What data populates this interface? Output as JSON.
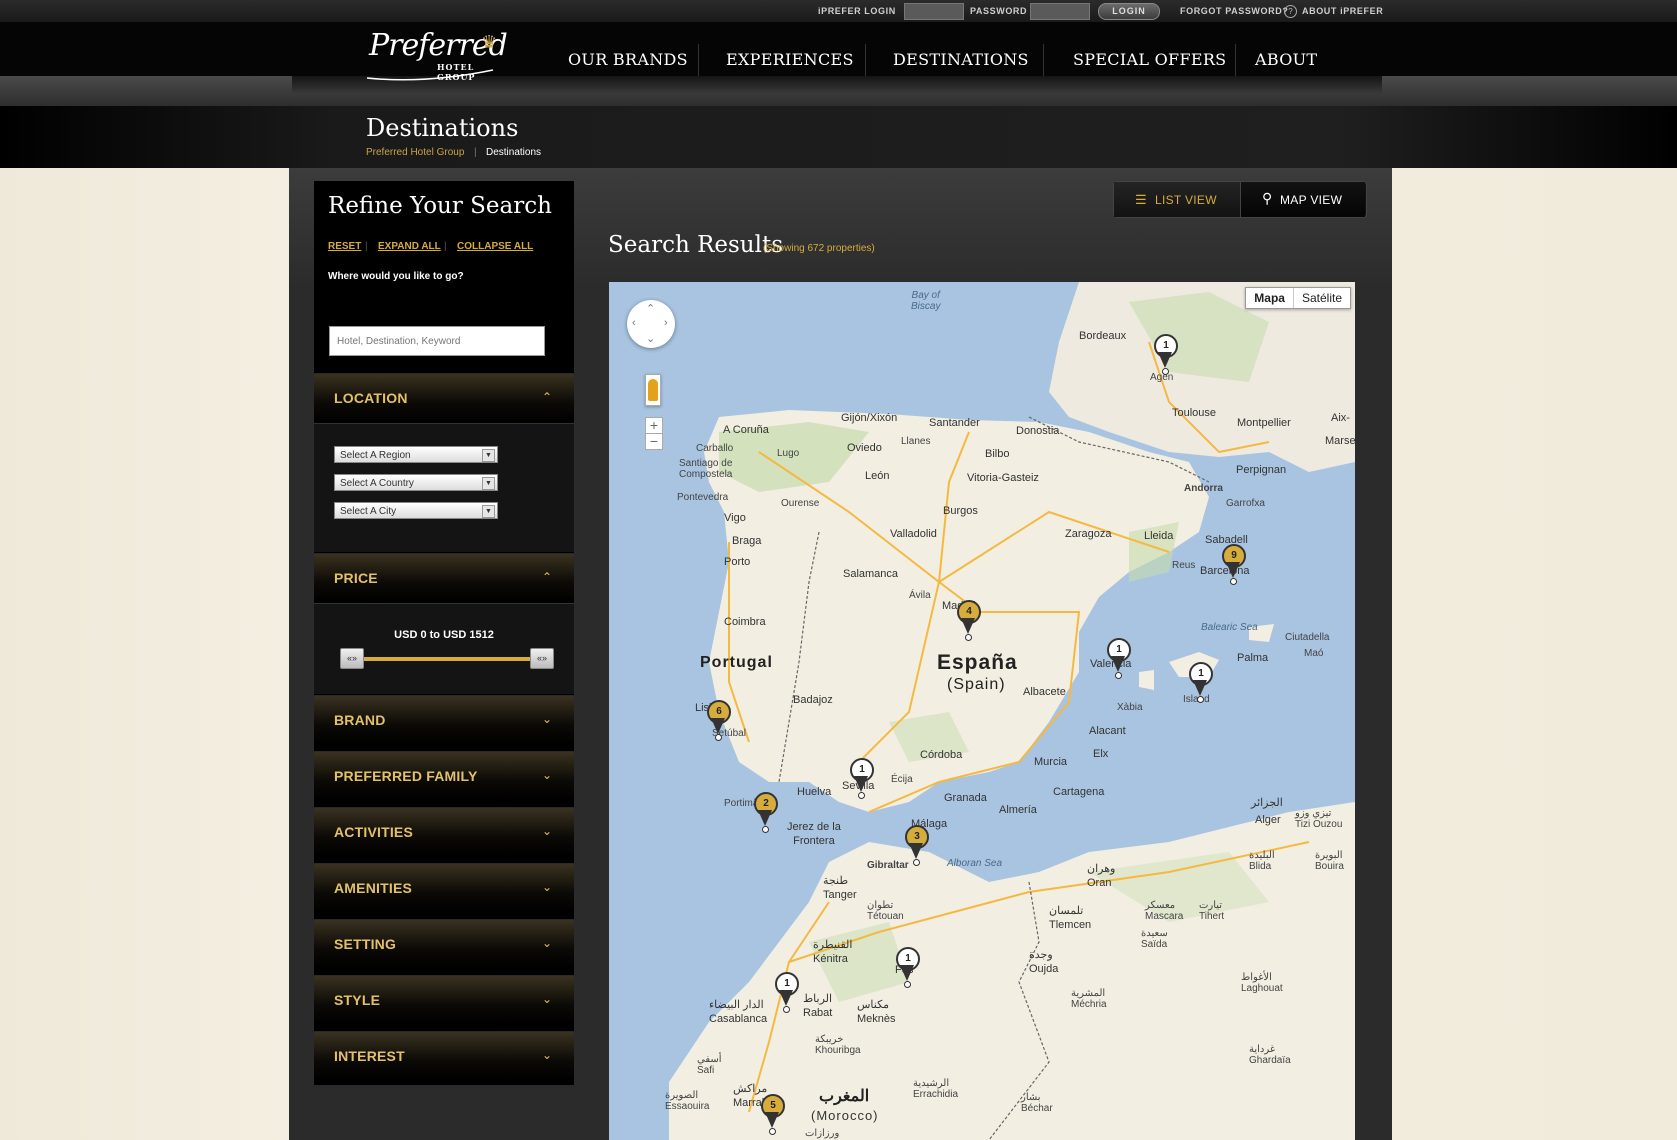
{
  "utility_bar": {
    "iprefer_login": "iPREFER LOGIN",
    "password": "PASSWORD",
    "login_button": "LOGIN",
    "forgot_password": "FORGOT PASSWORD?",
    "about_iprefer": "ABOUT iPREFER"
  },
  "logo": {
    "script": "Preferred",
    "sub": "HOTEL GROUP"
  },
  "nav": {
    "items": [
      "OUR BRANDS",
      "EXPERIENCES",
      "DESTINATIONS",
      "SPECIAL OFFERS",
      "ABOUT"
    ]
  },
  "page": {
    "title": "Destinations",
    "breadcrumb": [
      "Preferred Hotel Group",
      "Destinations"
    ],
    "breadcrumb_sep": "|"
  },
  "sidebar": {
    "title": "Refine Your Search",
    "links": [
      "RESET",
      "EXPAND ALL",
      "COLLAPSE ALL"
    ],
    "link_sep": "|",
    "where_label": "Where would you like to go?",
    "search_placeholder": "Hotel, Destination, Keyword",
    "sections": {
      "location": "LOCATION",
      "price": "PRICE",
      "brand": "BRAND",
      "preferred_family": "PREFERRED FAMILY",
      "activities": "ACTIVITIES",
      "amenities": "AMENITIES",
      "setting": "SETTING",
      "style": "STYLE",
      "interest": "INTEREST"
    },
    "selects": [
      "Select A Region",
      "Select A Country",
      "Select A City"
    ],
    "price_label": "USD 0 to USD 1512",
    "price_min": 0,
    "price_max": 1512,
    "handle_glyph": "«»"
  },
  "results": {
    "list_view": "LIST VIEW",
    "map_view": "MAP VIEW",
    "title": "Search Results",
    "count_text": "(Showing 672 properties)"
  },
  "map": {
    "type_map": "Mapa",
    "type_satellite": "Satélite",
    "labels": {
      "bay_of_biscay": "Bay of\nBiscay",
      "bordeaux": "Bordeaux",
      "agen": "Agen",
      "toulouse": "Toulouse",
      "montpellier": "Montpellier",
      "aix": "Aix-",
      "marse": "Marse",
      "perpignan": "Perpignan",
      "andorra": "Andorra",
      "figueres": "Garrofxa",
      "gijon": "Gijón/Xixón",
      "santander": "Santander",
      "donostia": "Donostia",
      "a_coruna": "A Coruña",
      "oviedo": "Oviedo",
      "llanes": "Llanes",
      "bilbo": "Bilbo",
      "carballo": "Carballo",
      "lugo": "Lugo",
      "vitoria": "Vitoria-Gasteiz",
      "santiago": "Santiago de\nCompostela",
      "leon": "León",
      "pontevedra": "Pontevedra",
      "ourense": "Ourense",
      "burgos": "Burgos",
      "vigo": "Vigo",
      "valladolid": "Valladolid",
      "zaragoza": "Zaragoza",
      "lleida": "Lleida",
      "sabadell": "Sabadell",
      "braga": "Braga",
      "porto": "Porto",
      "reus": "Reus",
      "barcelona": "Barcelona",
      "salamanca": "Salamanca",
      "avila": "Ávila",
      "madrid": "Madrid",
      "coimbra": "Coimbra",
      "balearic": "Balearic Sea",
      "ciutadella": "Ciutadella",
      "mao": "Maó",
      "portugal": "Portugal",
      "espana": "España",
      "spain": "(Spain)",
      "valencia": "Valencia",
      "palma": "Palma",
      "albacete": "Albacete",
      "badajoz": "Badajoz",
      "xabia": "Xàbia",
      "island": "Island",
      "lisboa": "Lisboa",
      "setubal": "Setúbal",
      "alacant": "Alacant",
      "elx": "Elx",
      "cordoba": "Córdoba",
      "murcia": "Murcia",
      "ecija": "Écija",
      "huelva": "Huelva",
      "sevilla": "Sevilla",
      "cartagena": "Cartagena",
      "portimao": "Portimão",
      "granada": "Granada",
      "almeria": "Almería",
      "alger_ar": "الجزائر",
      "alger": "Alger",
      "tizi": "تيزي وزو\nTizi Ouzou",
      "jerez": "Jerez de la\nFrontera",
      "malaga": "Málaga",
      "gibraltar": "Gibraltar",
      "alboran": "Alboran Sea",
      "blida": "البليدة\nBlida",
      "bouira": "البويرة\nBouira",
      "tanger": "طنجة\nTanger",
      "oran": "وهران\nOran",
      "tetouan": "تطوان\nTétouan",
      "tlemcen": "تلمسان\nTlemcen",
      "mascara": "معسكر\nMascara",
      "tiaret": "تيارت\nTihert",
      "kenitra": "القنيطرة\nKénitra",
      "saida": "سعيدة\nSaïda",
      "oujda": "وجدة\nOujda",
      "fes": "Fès",
      "casablanca": "الدار البيضاء\nCasablanca",
      "rabat": "الرباط\nRabat",
      "meknes": "مكناس\nMeknès",
      "mechria": "المشرية\nMéchria",
      "laghouat": "الأغواط\nLaghouat",
      "khouribga": "خريبكة\nKhouribga",
      "safi": "أسفي\nSafi",
      "ghardaia": "غرداية\nGhardaïa",
      "marrakech": "مراكش\nMarrakech",
      "morocco_ar": "المغرب",
      "morocco": "(Morocco)",
      "errachidia": "الرشيدية\nErrachidia",
      "essaouira": "الصويرة\nEssaouira",
      "bechar": "بشار\nBéchar",
      "ouarzazate": "ورزازات"
    },
    "pins": [
      {
        "id": "agen",
        "count": "1",
        "gold": false
      },
      {
        "id": "barcelona",
        "count": "9",
        "gold": true
      },
      {
        "id": "madrid",
        "count": "4",
        "gold": true
      },
      {
        "id": "valencia",
        "count": "1",
        "gold": false
      },
      {
        "id": "ibiza",
        "count": "1",
        "gold": false
      },
      {
        "id": "lisboa",
        "count": "6",
        "gold": true
      },
      {
        "id": "sevilla",
        "count": "1",
        "gold": false
      },
      {
        "id": "algarve",
        "count": "2",
        "gold": true
      },
      {
        "id": "marbella",
        "count": "3",
        "gold": true
      },
      {
        "id": "fes",
        "count": "1",
        "gold": false
      },
      {
        "id": "casablanca",
        "count": "1",
        "gold": false
      },
      {
        "id": "marrakech",
        "count": "5",
        "gold": true
      }
    ]
  }
}
